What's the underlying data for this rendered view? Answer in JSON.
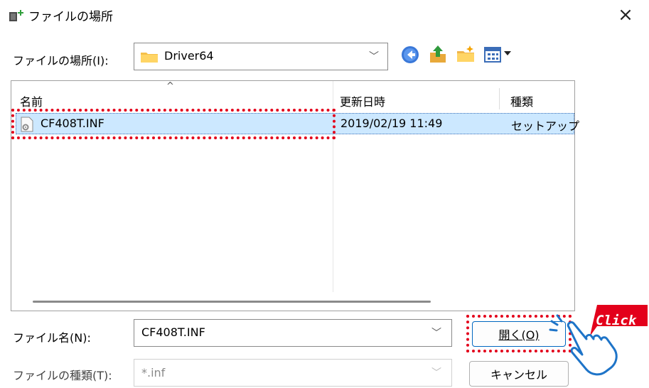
{
  "window": {
    "title": "ファイルの場所",
    "close_glyph": "×"
  },
  "location": {
    "label": "ファイルの場所(I):",
    "value": "Driver64",
    "folder_icon": "folder-icon",
    "nav_icons": [
      "back-arrow-icon",
      "up-folder-icon",
      "new-folder-icon",
      "view-menu-icon"
    ]
  },
  "file_list": {
    "columns": [
      "名前",
      "更新日時",
      "種類"
    ],
    "rows": [
      {
        "name": "CF408T.INF",
        "modified": "2019/02/19 11:49",
        "type": "セットアップ",
        "selected": true
      }
    ]
  },
  "filename": {
    "label": "ファイル名(N):",
    "value": "CF408T.INF"
  },
  "filetype": {
    "label": "ファイルの種類(T):",
    "value": "*.inf"
  },
  "buttons": {
    "open": "開く(O)",
    "cancel": "キャンセル"
  },
  "annotation": {
    "click_label": "Click",
    "highlight_color": "#e3001b"
  },
  "colors": {
    "selection": "#cce8ff",
    "accent": "#0067c0"
  }
}
